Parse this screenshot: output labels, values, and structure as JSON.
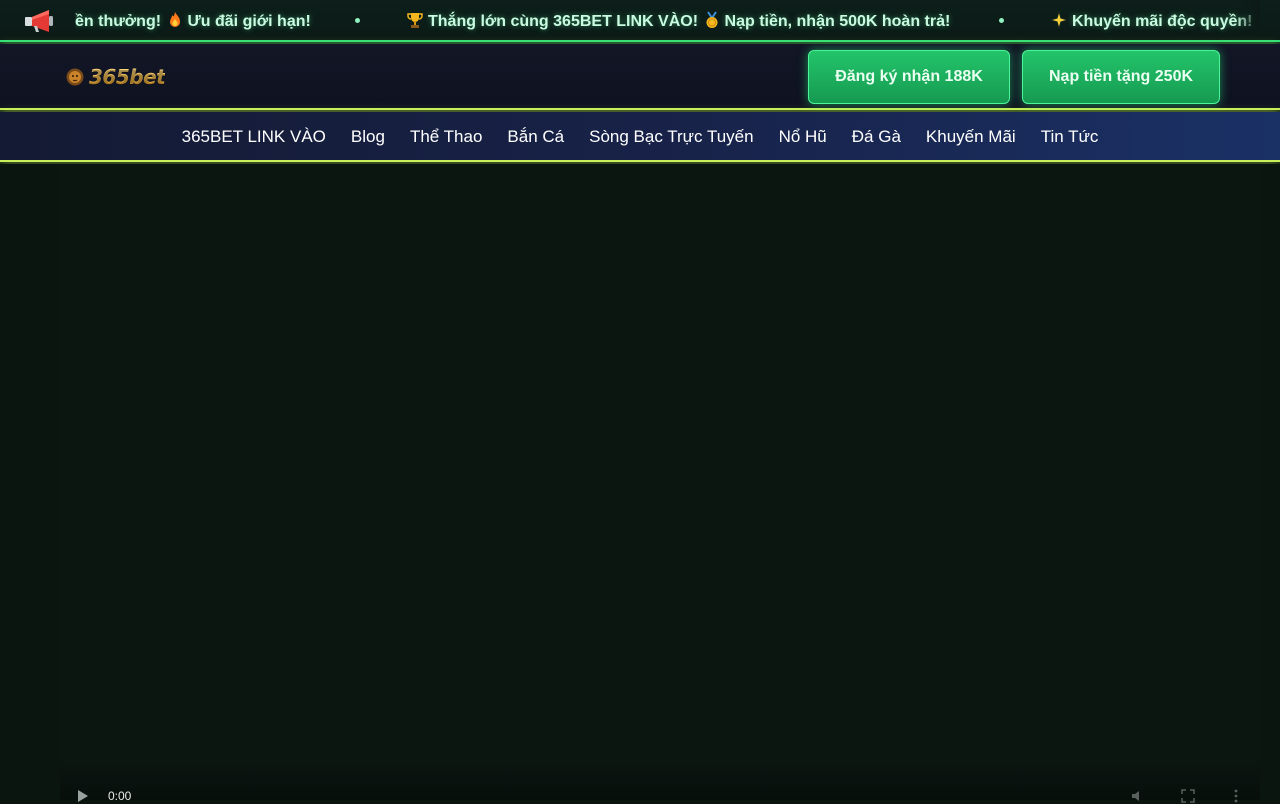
{
  "ticker": {
    "icon": "megaphone-icon",
    "messages": [
      {
        "icon": "fire-icon",
        "lead": "ền thưởng!",
        "text": "Ưu đãi giới hạn!"
      },
      {
        "icon": "trophy-icon",
        "text": "Thắng lớn cùng 365BET LINK VÀO!"
      },
      {
        "icon": "medal-icon",
        "text": "Nạp tiền, nhận 500K hoàn trả!"
      },
      {
        "icon": "sparkle-icon",
        "text": "Khuyến mãi độc quyền!"
      }
    ]
  },
  "header": {
    "logo_text": "365bet",
    "cta_register": "Đăng ký nhận 188K",
    "cta_deposit": "Nạp tiền tặng 250K"
  },
  "nav": {
    "items": [
      "365BET LINK VÀO",
      "Blog",
      "Thể Thao",
      "Bắn Cá",
      "Sòng Bạc Trực Tuyến",
      "Nổ Hũ",
      "Đá Gà",
      "Khuyến Mãi",
      "Tin Tức"
    ]
  },
  "video": {
    "current_time": "0:00"
  },
  "colors": {
    "ticker_border": "#2fe07a",
    "header_border": "#c8f05a",
    "cta_green": "#1fb862",
    "logo_gold": "#f3b73a",
    "page_bg": "#0a1510"
  }
}
